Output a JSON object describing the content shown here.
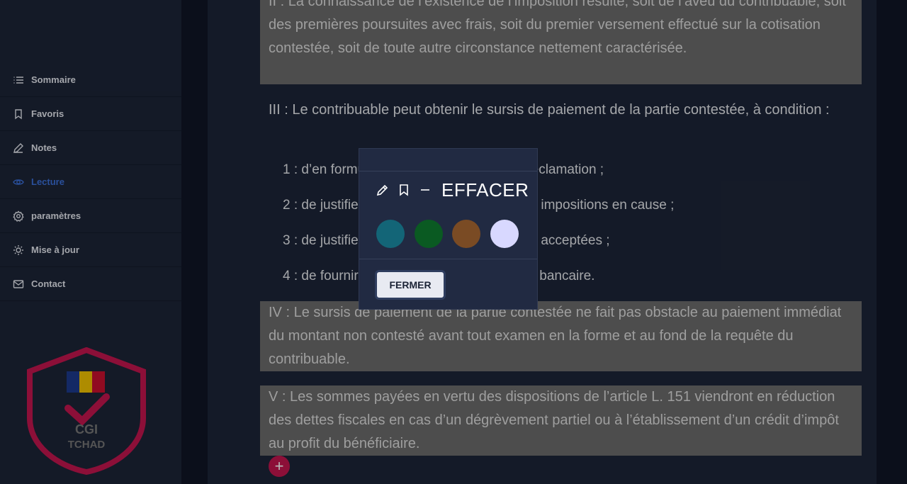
{
  "sidebar": {
    "items": [
      {
        "label": "Sommaire",
        "icon": "list-icon"
      },
      {
        "label": "Favoris",
        "icon": "bookmark-icon"
      },
      {
        "label": "Notes",
        "icon": "pencil-icon"
      },
      {
        "label": "Lecture",
        "icon": "eye-icon",
        "active": true
      },
      {
        "label": "paramètres",
        "icon": "gear-icon"
      },
      {
        "label": "Mise à jour",
        "icon": "sun-icon"
      },
      {
        "label": "Contact",
        "icon": "mail-icon"
      }
    ],
    "logo_text_1": "CGI",
    "logo_text_2": "TCHAD"
  },
  "content": {
    "para_ii": "II : La connaissance de l’existence de l’imposition résulte, soit de l’aveu du contribuable, soit des premières poursuites avec frais, soit du premier versement effectué sur la cotisation contestée, soit de toute autre circonstance nettement caractérisée.",
    "para_iii": "III : Le contribuable peut obtenir le sursis de paiement de la partie contestée, à condition :",
    "item_1": "1 : d’en formuler la demande dans ladite réclamation ;",
    "item_2": "2 : de justifier du paiement du montant des impositions en cause ;",
    "item_3": "3 : de justifier du paiement des impositions acceptées ;",
    "item_4": "4 : de fournir la caution d’un établissement bancaire.",
    "para_iv": "IV : Le sursis de paiement de la partie contestée ne fait pas obstacle au paiement immédiat du montant non contesté avant tout examen en la forme et au fond de la requête du contribuable.",
    "para_v": "V : Les sommes payées en vertu des dispositions de l’article L. 151 viendront en réduction des dettes fiscales en cas d’un dégrèvement partiel ou à l’établissement d’un crédit d’impôt au profit du bénéficiaire.",
    "plus_label": "+"
  },
  "popup": {
    "effacer_label": "EFFACER",
    "fermer_label": "FERMER",
    "tool_icons": [
      "pencil-icon",
      "bookmark-icon",
      "minus-icon"
    ],
    "colors": [
      "#136577",
      "#0a5a22",
      "#7a4b24",
      "#d8d8ff"
    ]
  },
  "theme": {
    "accent": "#3b6fd8",
    "highlight": "#6b6b6b",
    "brand": "#c2164e"
  }
}
